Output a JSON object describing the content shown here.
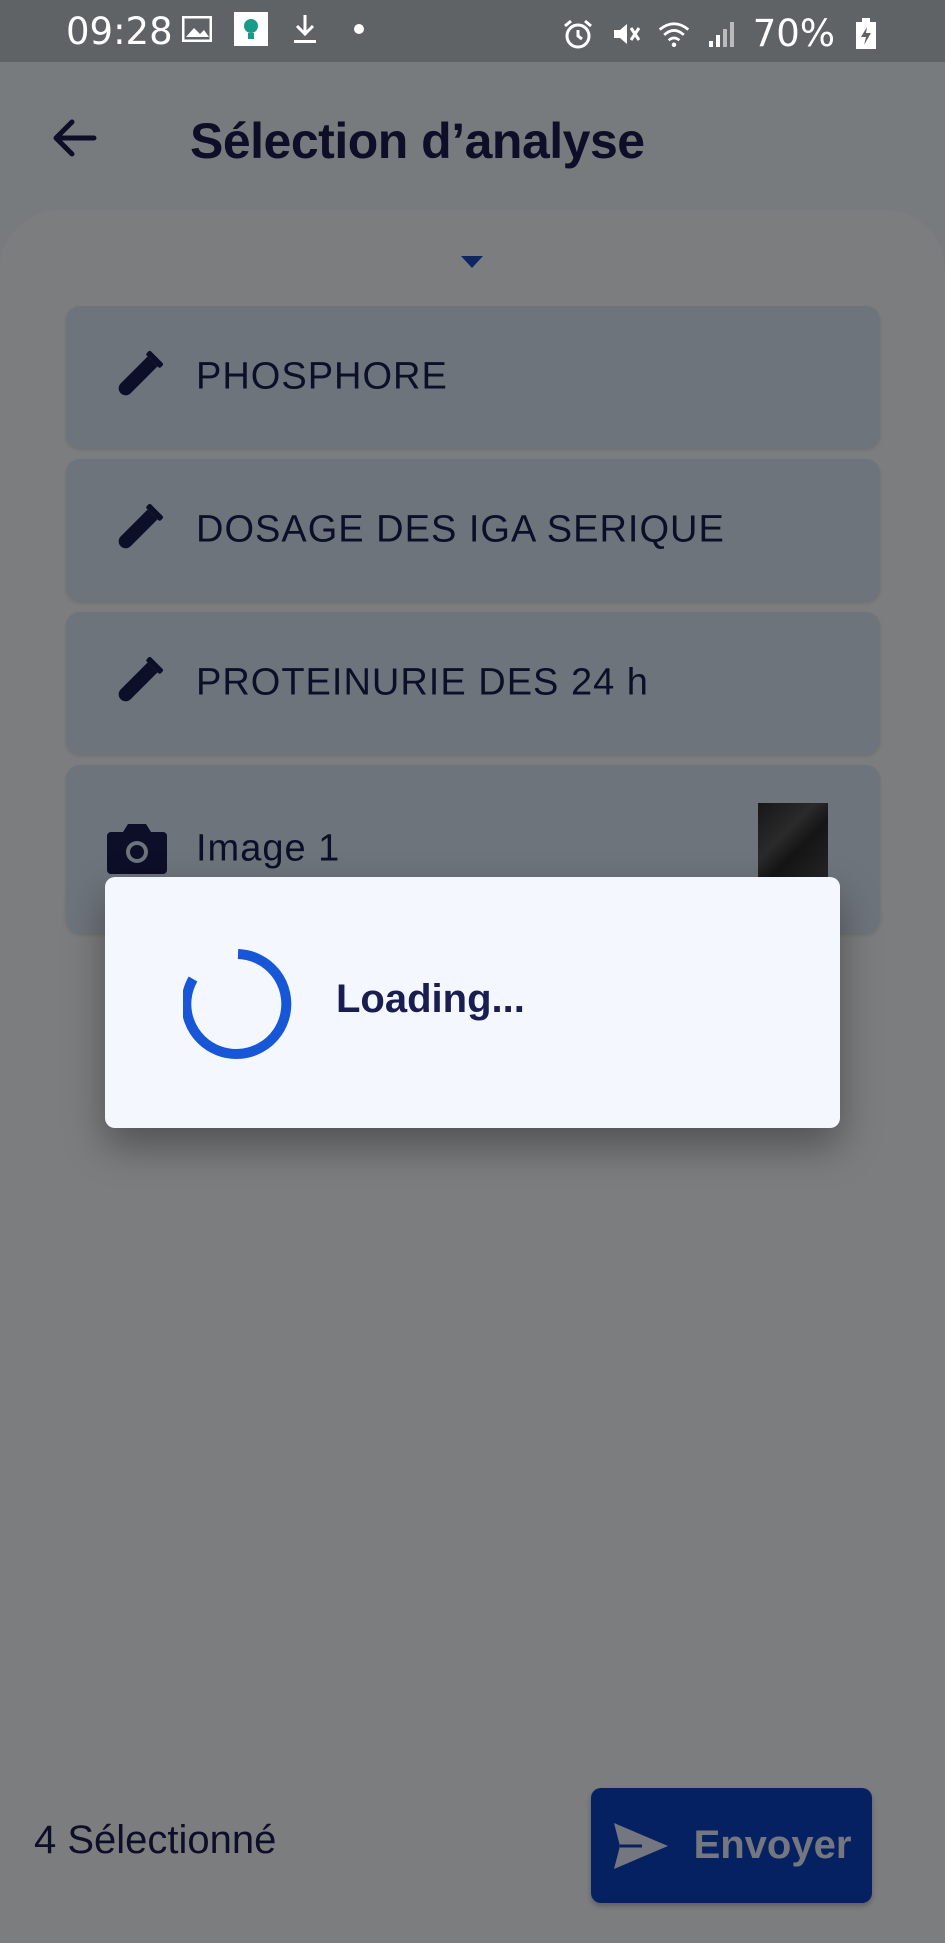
{
  "status_bar": {
    "time": "09:28",
    "battery": "70%"
  },
  "header": {
    "title": "Sélection d’analyse"
  },
  "analyses": [
    {
      "label": "PHOSPHORE",
      "icon": "test-tube-icon"
    },
    {
      "label": "DOSAGE DES IGA SERIQUE",
      "icon": "test-tube-icon"
    },
    {
      "label": "PROTEINURIE DES 24 h",
      "icon": "test-tube-icon"
    },
    {
      "label": "Image 1",
      "icon": "camera-icon"
    }
  ],
  "footer": {
    "selected_count": "4 Sélectionné",
    "send_label": "Envoyer"
  },
  "dialog": {
    "message": "Loading..."
  },
  "colors": {
    "primary": "#0d43c4",
    "text": "#1a1d4f",
    "card": "#dde8f7",
    "spinner": "#1756d6"
  }
}
